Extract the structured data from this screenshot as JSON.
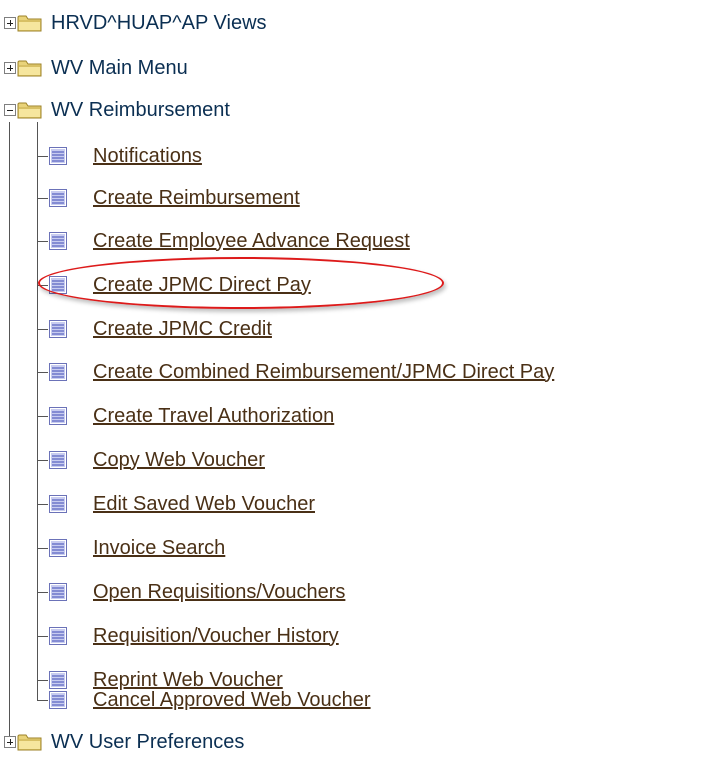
{
  "tree": {
    "folders": [
      {
        "label": "HRVD^HUAP^AP Views",
        "expanded": false,
        "toggle_icon": "plus-box-icon"
      },
      {
        "label": "WV Main Menu",
        "expanded": false,
        "toggle_icon": "plus-box-icon"
      },
      {
        "label": "WV Reimbursement",
        "expanded": true,
        "toggle_icon": "minus-box-icon"
      },
      {
        "label": "WV User Preferences",
        "expanded": false,
        "toggle_icon": "plus-box-icon"
      }
    ],
    "reimbursement_items": [
      {
        "label": "Notifications"
      },
      {
        "label": "Create Reimbursement"
      },
      {
        "label": "Create Employee Advance Request"
      },
      {
        "label": "Create JPMC Direct Pay",
        "highlighted": true
      },
      {
        "label": "Create JPMC Credit"
      },
      {
        "label": "Create Combined Reimbursement/JPMC Direct Pay"
      },
      {
        "label": "Create Travel Authorization"
      },
      {
        "label": "Copy Web Voucher"
      },
      {
        "label": "Edit Saved Web Voucher"
      },
      {
        "label": "Invoice Search"
      },
      {
        "label": "Open Requisitions/Vouchers"
      },
      {
        "label": "Requisition/Voucher History"
      },
      {
        "label": "Reprint Web Voucher"
      },
      {
        "label": "Cancel Approved Web Voucher"
      }
    ]
  },
  "colors": {
    "folder_text": "#0b2f52",
    "link_text": "#4a3016",
    "highlight_ellipse": "#dd1a1a",
    "folder_icon": "#e9d37a",
    "page_icon": "#8a93d6"
  }
}
